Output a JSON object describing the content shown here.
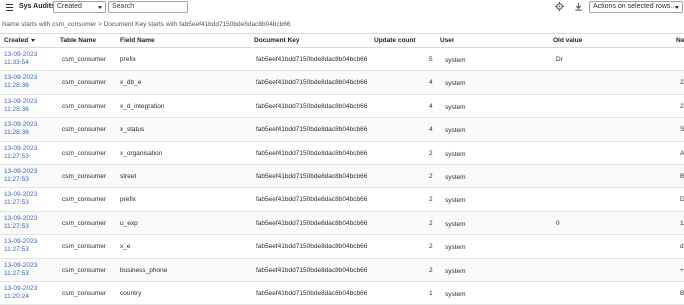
{
  "header": {
    "title": "Sys Audits",
    "filter_field": "Created",
    "search_placeholder": "Search",
    "actions_label": "Actions on selected rows..."
  },
  "breadcrumb": "Name starts with csm_consumer > Document Key starts with fab5eef41bdd7150bde8dac8b04bcb66",
  "columns": [
    "Created",
    "Table Name",
    "Field Name",
    "Document Key",
    "Update count",
    "User",
    "Old value",
    "Ne"
  ],
  "rows": [
    {
      "date": "13-09-2023",
      "time": "11:33:54",
      "table": "csm_consumer",
      "field": "prefix",
      "doc": "fab5eef41bdd7150bde8dac8b04bcb66",
      "count": "5",
      "user": "system",
      "old": "Dr",
      "new": ""
    },
    {
      "date": "13-09-2023",
      "time": "11:28:36",
      "table": "csm_consumer",
      "field": "x_db_e",
      "doc": "fab5eef41bdd7150bde8dac8b04bcb66",
      "count": "4",
      "user": "system",
      "old": "",
      "new": "2"
    },
    {
      "date": "13-09-2023",
      "time": "11:28:36",
      "table": "csm_consumer",
      "field": "x_d_integration",
      "doc": "fab5eef41bdd7150bde8dac8b04bcb66",
      "count": "4",
      "user": "system",
      "old": "",
      "new": "2"
    },
    {
      "date": "13-09-2023",
      "time": "11:28:36",
      "table": "csm_consumer",
      "field": "x_status",
      "doc": "fab5eef41bdd7150bde8dac8b04bcb66",
      "count": "4",
      "user": "system",
      "old": "",
      "new": "S"
    },
    {
      "date": "13-09-2023",
      "time": "11:27:53",
      "table": "csm_consumer",
      "field": "x_organisation",
      "doc": "fab5eef41bdd7150bde8dac8b04bcb66",
      "count": "2",
      "user": "system",
      "old": "",
      "new": "A"
    },
    {
      "date": "13-09-2023",
      "time": "11:27:53",
      "table": "csm_consumer",
      "field": "street",
      "doc": "fab5eef41bdd7150bde8dac8b04bcb66",
      "count": "2",
      "user": "system",
      "old": "",
      "new": "B"
    },
    {
      "date": "13-09-2023",
      "time": "11:27:53",
      "table": "csm_consumer",
      "field": "prefix",
      "doc": "fab5eef41bdd7150bde8dac8b04bcb66",
      "count": "2",
      "user": "system",
      "old": "",
      "new": "D"
    },
    {
      "date": "13-09-2023",
      "time": "11:27:53",
      "table": "csm_consumer",
      "field": "u_exp",
      "doc": "fab5eef41bdd7150bde8dac8b04bcb66",
      "count": "2",
      "user": "system",
      "old": "0",
      "new": "1"
    },
    {
      "date": "13-09-2023",
      "time": "11:27:53",
      "table": "csm_consumer",
      "field": "x_e",
      "doc": "fab5eef41bdd7150bde8dac8b04bcb66",
      "count": "2",
      "user": "system",
      "old": "",
      "new": "d"
    },
    {
      "date": "13-09-2023",
      "time": "11:27:53",
      "table": "csm_consumer",
      "field": "business_phone",
      "doc": "fab5eef41bdd7150bde8dac8b04bcb66",
      "count": "2",
      "user": "system",
      "old": "",
      "new": "+"
    },
    {
      "date": "13-09-2023",
      "time": "11:20:24",
      "table": "csm_consumer",
      "field": "country",
      "doc": "fab5eef41bdd7150bde8dac8b04bcb66",
      "count": "1",
      "user": "system",
      "old": "",
      "new": "B"
    }
  ]
}
